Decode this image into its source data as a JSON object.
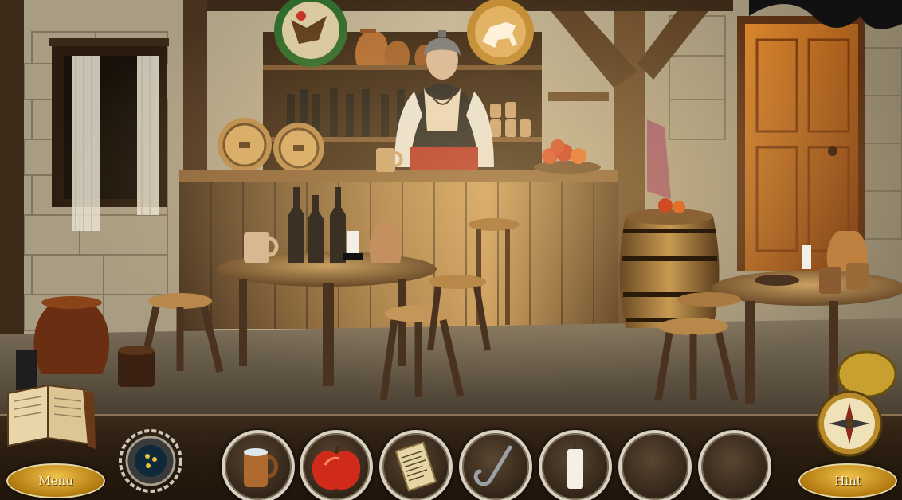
{
  "game": {
    "scene_name": "tavern",
    "hud": {
      "menu_label": "Menu",
      "hint_label": "Hint"
    },
    "inventory": [
      {
        "slot": 1,
        "item": "clay-mug"
      },
      {
        "slot": 2,
        "item": "red-apple"
      },
      {
        "slot": 3,
        "item": "parchment-scroll"
      },
      {
        "slot": 4,
        "item": "iron-hook"
      },
      {
        "slot": 5,
        "item": "white-candle"
      },
      {
        "slot": 6,
        "item": ""
      },
      {
        "slot": 7,
        "item": ""
      }
    ],
    "icons": {
      "journal": "open-book-icon",
      "map_amulet": "amulet-icon",
      "compass": "compass-icon",
      "pocket_watch": "pocket-watch-icon"
    },
    "colors": {
      "wall_stone": "#b8ab90",
      "wood_dark": "#3d2a18",
      "wood_light": "#a37a45",
      "door": "#b8641c",
      "button_gold": "#d9a22a",
      "slot_rim": "#d8d0c0"
    }
  }
}
